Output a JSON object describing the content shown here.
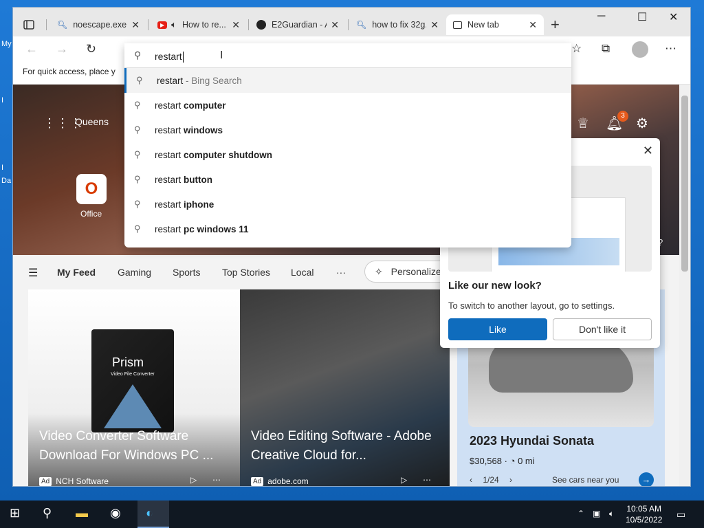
{
  "desktop": {
    "labels": [
      "My",
      "I",
      "I",
      "Da"
    ]
  },
  "tabs": [
    {
      "title": "noescape.exe ...",
      "icon": "search-icon"
    },
    {
      "title": "How to re...",
      "icon": "youtube-icon"
    },
    {
      "title": "E2Guardian - A...",
      "icon": "github-icon"
    },
    {
      "title": "how to fix 32g...",
      "icon": "search-icon"
    },
    {
      "title": "New tab",
      "icon": "newtab-icon"
    }
  ],
  "window_controls": {
    "minimize": "─",
    "maximize": "☐",
    "close": "✕"
  },
  "favbar": {
    "text": "For quick access, place y"
  },
  "omnibox": {
    "value": "restart",
    "suggestions": [
      {
        "prefix": "restart",
        "bold": "",
        "suffix": " - Bing Search"
      },
      {
        "prefix": "restart ",
        "bold": "computer",
        "suffix": ""
      },
      {
        "prefix": "restart ",
        "bold": "windows",
        "suffix": ""
      },
      {
        "prefix": "restart ",
        "bold": "computer shutdown",
        "suffix": ""
      },
      {
        "prefix": "restart ",
        "bold": "button",
        "suffix": ""
      },
      {
        "prefix": "restart ",
        "bold": "iphone",
        "suffix": ""
      },
      {
        "prefix": "restart ",
        "bold": "pc windows 11",
        "suffix": ""
      }
    ]
  },
  "hero": {
    "location": "Queens",
    "office_label": "Office",
    "notifications": "3",
    "help_glyph": "?"
  },
  "feed": {
    "tabs": [
      "My Feed",
      "Gaming",
      "Sports",
      "Top Stories",
      "Local",
      "···"
    ],
    "personalize": "Personalize"
  },
  "cards": [
    {
      "title": "Video Converter Software Download For Windows PC ...",
      "ad": "Ad",
      "source": "NCH Software",
      "box_title": "Prism",
      "box_subtitle": "Video File Converter"
    },
    {
      "title": "Video Editing Software - Adobe Creative Cloud for...",
      "ad": "Ad",
      "source": "adobe.com"
    }
  ],
  "car_card": {
    "title": "2023 Hyundai Sonata",
    "price": "$30,568",
    "mileage": "0 mi",
    "pager": "1/24",
    "cta": "See cars near you"
  },
  "popup": {
    "title": "Like our new look?",
    "desc": "To switch to another layout, go to settings.",
    "like": "Like",
    "dislike": "Don't like it"
  },
  "clock": {
    "time": "10:05 AM",
    "date": "10/5/2022"
  },
  "colors": {
    "accent": "#0f6cbd",
    "badge": "#e55a1c",
    "taskbar": "#101822"
  }
}
